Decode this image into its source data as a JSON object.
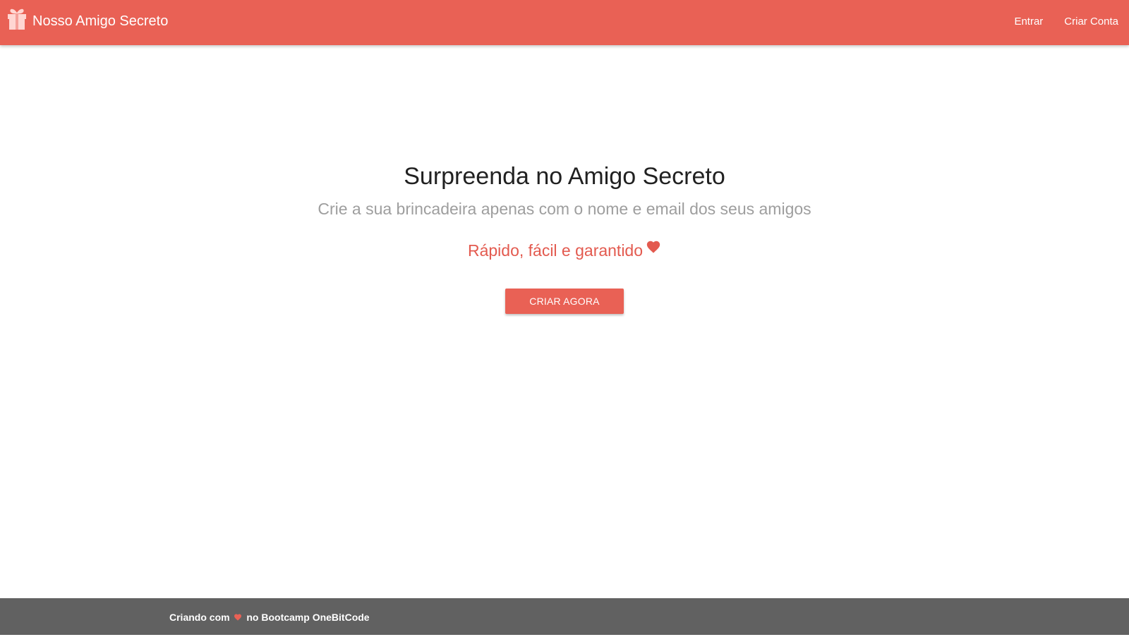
{
  "navbar": {
    "brand_icon": "gift-icon",
    "brand_text": "Nosso Amigo Secreto",
    "links": [
      {
        "label": "Entrar"
      },
      {
        "label": "Criar Conta"
      }
    ]
  },
  "hero": {
    "title": "Surpreenda no Amigo Secreto",
    "subtitle": "Crie a sua brincadeira apenas com o nome e email dos seus amigos",
    "tagline": "Rápido, fácil e garantido",
    "tagline_icon": "heart-icon",
    "cta_label": "CRIAR AGORA"
  },
  "footer": {
    "text_before": "Criando com",
    "icon": "heart-icon",
    "text_after": "no Bootcamp OneBitCode"
  },
  "colors": {
    "primary": "#e96155",
    "footer_bg": "#616161",
    "title": "#212121",
    "subtitle": "#9e9e9e"
  }
}
